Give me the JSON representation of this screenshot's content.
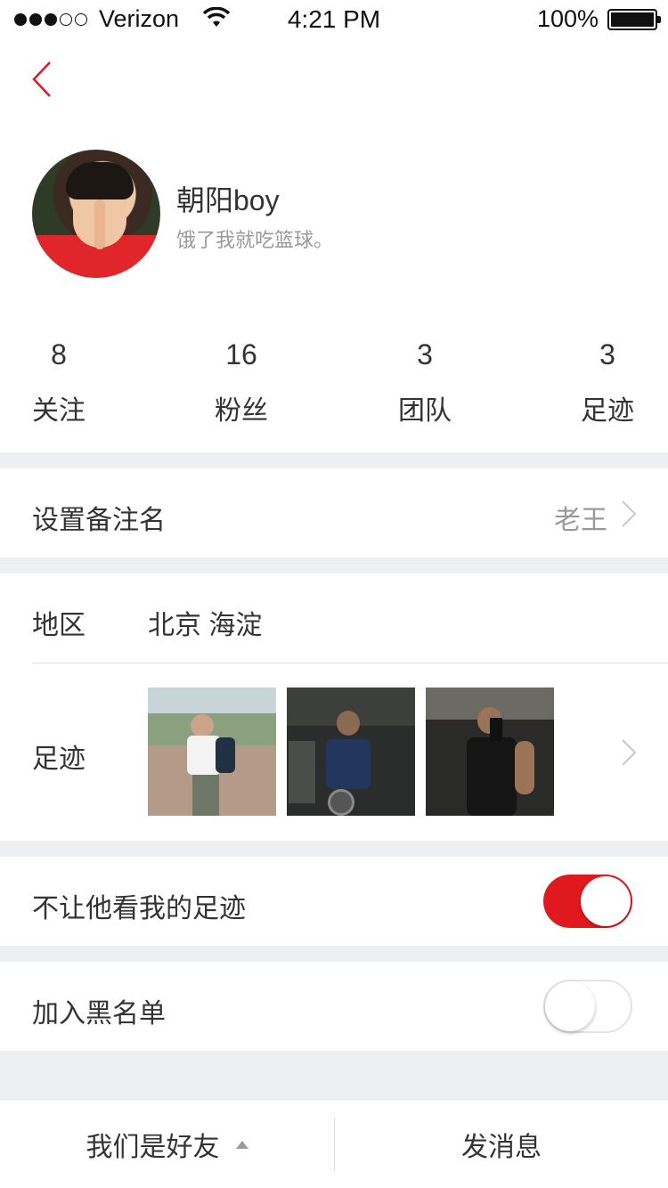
{
  "status_bar": {
    "carrier": "Verizon",
    "time": "4:21 PM",
    "battery": "100%"
  },
  "profile": {
    "nickname": "朝阳boy",
    "signature": "饿了我就吃篮球。"
  },
  "stats": [
    {
      "value": "8",
      "label": "关注"
    },
    {
      "value": "16",
      "label": "粉丝"
    },
    {
      "value": "3",
      "label": "团队"
    },
    {
      "value": "3",
      "label": "足迹"
    }
  ],
  "remark": {
    "label": "设置备注名",
    "value": "老王"
  },
  "region": {
    "label": "地区",
    "value": "北京 海淀"
  },
  "footprint": {
    "label": "足迹"
  },
  "hide_footprint": {
    "label": "不让他看我的足迹",
    "on": true
  },
  "blacklist": {
    "label": "加入黑名单",
    "on": false
  },
  "bottom": {
    "friend_label": "我们是好友",
    "message_label": "发消息"
  },
  "colors": {
    "accent": "#e0191f",
    "separator": "#eeeff1",
    "secondary_text": "#999999"
  }
}
